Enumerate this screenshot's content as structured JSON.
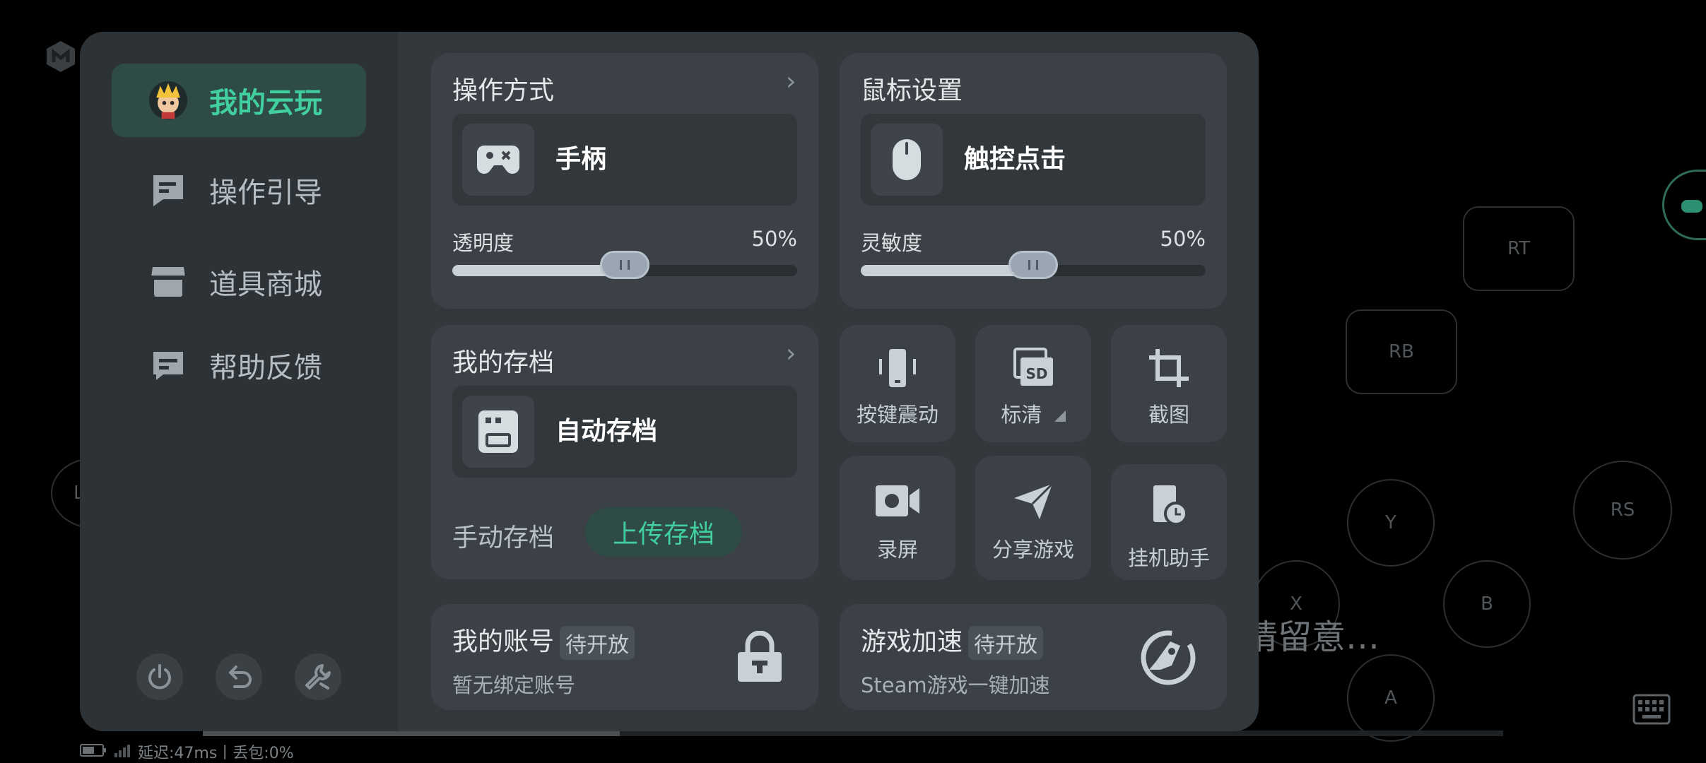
{
  "sidebar": {
    "items": [
      {
        "label": "我的云玩",
        "icon": "avatar",
        "active": true
      },
      {
        "label": "操作引导",
        "icon": "guide-icon"
      },
      {
        "label": "道具商城",
        "icon": "store-icon"
      },
      {
        "label": "帮助反馈",
        "icon": "feedback-icon"
      }
    ],
    "bottom_icons": [
      "power-icon",
      "undo-icon",
      "settings-wrench-icon"
    ]
  },
  "control_card": {
    "title": "操作方式",
    "mode_label": "手柄",
    "slider_label": "透明度",
    "slider_value_text": "50%",
    "slider_fraction": 0.5
  },
  "mouse_card": {
    "title": "鼠标设置",
    "mode_label": "触控点击",
    "slider_label": "灵敏度",
    "slider_value_text": "50%",
    "slider_fraction": 0.5
  },
  "save_card": {
    "title": "我的存档",
    "auto_label": "自动存档",
    "manual_label": "手动存档",
    "upload_label": "上传存档"
  },
  "tiles": [
    {
      "label": "按键震动",
      "icon": "phone-vibrate-icon"
    },
    {
      "label": "标清",
      "icon": "sd-quality-icon"
    },
    {
      "label": "截图",
      "icon": "crop-icon"
    },
    {
      "label": "录屏",
      "icon": "video-record-icon"
    },
    {
      "label": "分享游戏",
      "icon": "share-send-icon"
    },
    {
      "label": "挂机助手",
      "icon": "idle-assistant-icon"
    }
  ],
  "account_card": {
    "title": "我的账号",
    "badge": "待开放",
    "subtitle": "暂无绑定账号"
  },
  "boost_card": {
    "title": "游戏加速",
    "badge": "待开放",
    "subtitle": "Steam游戏一键加速"
  },
  "gamepad": {
    "buttons": [
      "RT",
      "RB",
      "RS",
      "Y",
      "X",
      "B",
      "A",
      "L"
    ],
    "notice_text": "请留意…"
  },
  "status_bar": {
    "text": "延迟:47ms丨丢包:0%"
  },
  "colors": {
    "accent": "#41cfa0",
    "panel": "#33383d",
    "sidebar": "#2d3236",
    "card": "#3b4146"
  }
}
